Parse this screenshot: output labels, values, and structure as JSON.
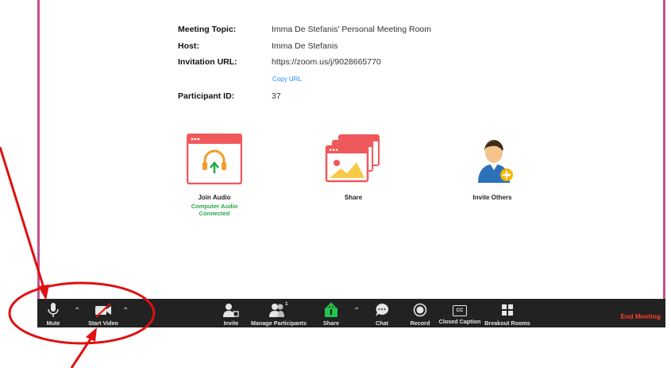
{
  "meeting": {
    "topic_label": "Meeting Topic:",
    "topic": "Imma De Stefanis' Personal Meeting Room",
    "host_label": "Host:",
    "host": "Imma De Stefanis",
    "url_label": "Invitation URL:",
    "url": "https://zoom.us/j/9028665770",
    "copy_url": "Copy URL",
    "participant_label": "Participant ID:",
    "participant_id": "37"
  },
  "actions": {
    "join_audio": "Join Audio",
    "audio_status": "Computer Audio Connected",
    "share": "Share",
    "invite_others": "Invite Others"
  },
  "toolbar": {
    "mute": "Mute",
    "start_video": "Start Video",
    "invite": "Invite",
    "manage_participants": "Manage Participants",
    "participant_count": "1",
    "share": "Share",
    "chat": "Chat",
    "record": "Record",
    "closed_caption": "Closed Caption",
    "cc_badge": "CC",
    "breakout_rooms": "Breakout Rooms",
    "end_meeting": "End Meeting"
  },
  "colors": {
    "accent_red": "#e01010",
    "tile_red": "#f0595c",
    "audio_green": "#25a848",
    "toolbar_bg": "#222222",
    "link_blue": "#2d8cff",
    "end_red": "#ff3b30"
  }
}
